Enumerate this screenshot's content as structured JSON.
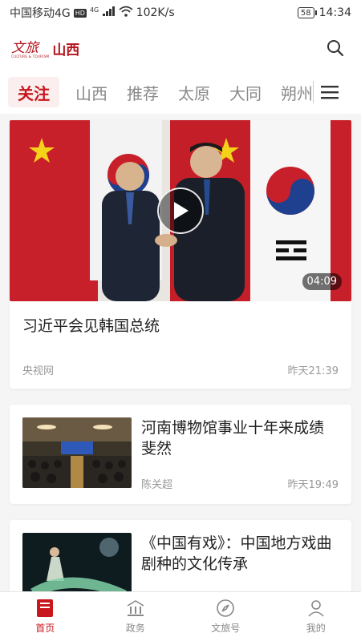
{
  "status_bar": {
    "carrier": "中国移动4G",
    "hd": "HD",
    "signal_type": "4G",
    "speed": "102K/s",
    "battery": "58",
    "time": "14:34"
  },
  "header": {
    "logo_script": "文旅",
    "logo_sub": "CULTURE & TOURISM",
    "logo_main": "山西",
    "search_icon": "search-icon"
  },
  "tabs": [
    {
      "label": "关注",
      "active": true
    },
    {
      "label": "山西",
      "active": false
    },
    {
      "label": "推荐",
      "active": false
    },
    {
      "label": "太原",
      "active": false
    },
    {
      "label": "大同",
      "active": false
    },
    {
      "label": "朔州",
      "active": false
    }
  ],
  "feed": {
    "featured": {
      "title": "习近平会见韩国总统",
      "source": "央视网",
      "time": "昨天21:39",
      "duration": "04:09"
    },
    "articles": [
      {
        "title": "河南博物馆事业十年来成绩斐然",
        "author": "陈关超",
        "time": "昨天19:49"
      },
      {
        "title": "《中国有戏》：中国地方戏曲剧种的文化传承",
        "author": "",
        "time": ""
      }
    ]
  },
  "bottom_nav": [
    {
      "label": "首页",
      "icon": "home-icon",
      "active": true
    },
    {
      "label": "政务",
      "icon": "government-icon",
      "active": false
    },
    {
      "label": "文旅号",
      "icon": "compass-icon",
      "active": false
    },
    {
      "label": "我的",
      "icon": "profile-icon",
      "active": false
    }
  ],
  "colors": {
    "accent": "#c8161d",
    "inactive": "#8a8a8a"
  }
}
